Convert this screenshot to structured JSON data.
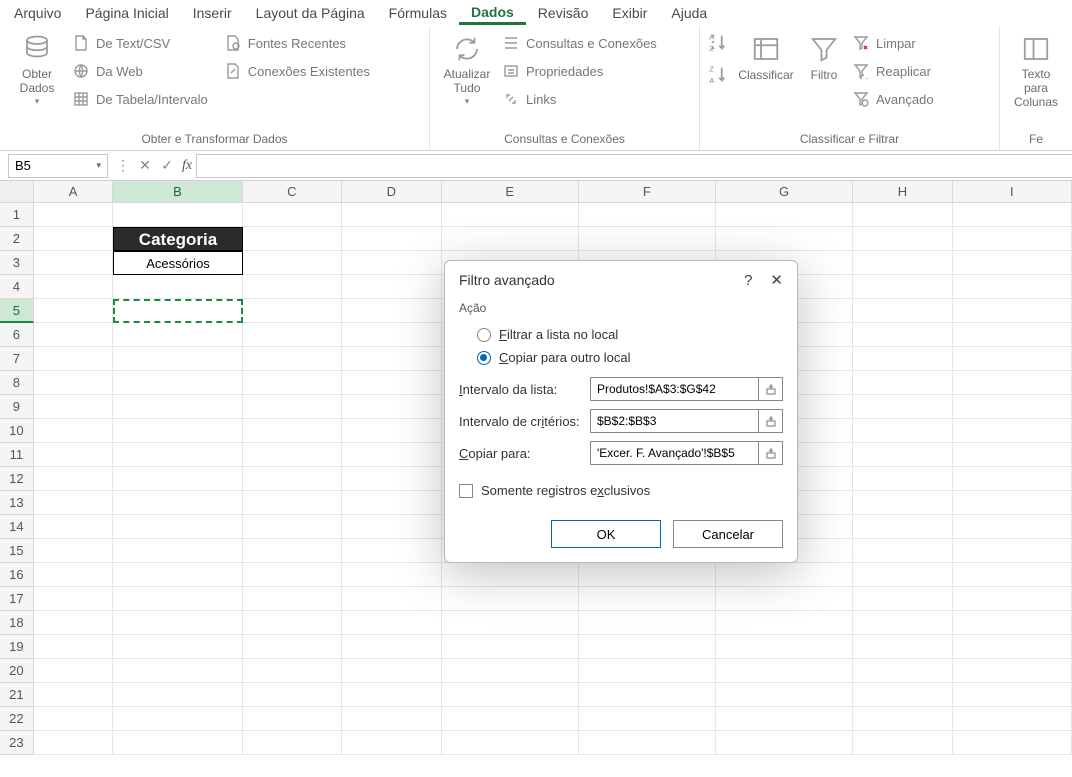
{
  "menubar": [
    "Arquivo",
    "Página Inicial",
    "Inserir",
    "Layout da Página",
    "Fórmulas",
    "Dados",
    "Revisão",
    "Exibir",
    "Ajuda"
  ],
  "menubar_active_index": 5,
  "ribbon": {
    "group_getdata": {
      "big": "Obter\nDados",
      "items": [
        "De Text/CSV",
        "Da Web",
        "De Tabela/Intervalo",
        "Fontes Recentes",
        "Conexões Existentes"
      ],
      "label": "Obter e Transformar Dados"
    },
    "group_queries": {
      "big": "Atualizar\nTudo",
      "items": [
        "Consultas e Conexões",
        "Propriedades",
        "Links"
      ],
      "label": "Consultas e Conexões"
    },
    "group_sort": {
      "sort_btn": "Classificar",
      "filter_btn": "Filtro",
      "items": [
        "Limpar",
        "Reaplicar",
        "Avançado"
      ],
      "label": "Classificar e Filtrar"
    },
    "group_text": {
      "big": "Texto para\nColunas",
      "label": "Ferramentas"
    }
  },
  "namebox": "B5",
  "formula": "",
  "columns": [
    "A",
    "B",
    "C",
    "D",
    "E",
    "F",
    "G",
    "H",
    "I"
  ],
  "col_widths": [
    "col-A",
    "col-B",
    "col-C",
    "col-D",
    "col-E",
    "col-F",
    "col-G",
    "col-H",
    "col-I"
  ],
  "row_count": 23,
  "sheet": {
    "b2": "Categoria",
    "b3": "Acessórios"
  },
  "dialog": {
    "title": "Filtro avançado",
    "action_label": "Ação",
    "radio1_pre": "F",
    "radio1_post": "iltrar a lista no local",
    "radio2_pre": "C",
    "radio2_post": "opiar para outro local",
    "radio_selected": 2,
    "list_pre": "I",
    "list_post": "ntervalo da lista:",
    "list_val": "Produtos!$A$3:$G$42",
    "crit_pre": "i",
    "crit_label_a": "Intervalo de cr",
    "crit_post": "térios:",
    "crit_val": "$B$2:$B$3",
    "copy_pre": "C",
    "copy_post": "opiar para:",
    "copy_val": "'Excer. F. Avançado'!$B$5",
    "unique_pre": "x",
    "unique_label_a": "Somente registros e",
    "unique_post": "clusivos",
    "ok": "OK",
    "cancel": "Cancelar"
  }
}
